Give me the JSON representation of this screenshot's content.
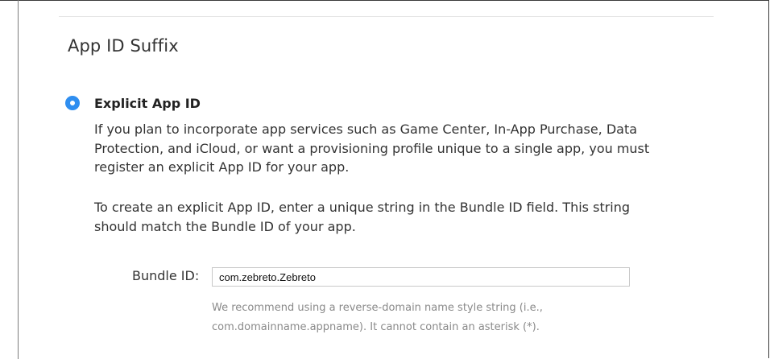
{
  "section": {
    "title": "App ID Suffix"
  },
  "option": {
    "label": "Explicit App ID",
    "selected": true,
    "accent_color": "#2f8ef0",
    "description_1": "If you plan to incorporate app services such as Game Center, In-App Purchase, Data Protection, and iCloud, or want a provisioning profile unique to a single app, you must register an explicit App ID for your app.",
    "description_2": "To create an explicit App ID, enter a unique string in the Bundle ID field. This string should match the Bundle ID of your app."
  },
  "bundle": {
    "label": "Bundle ID:",
    "value": "com.zebreto.Zebreto",
    "help_line_1": "We recommend using a reverse-domain name style string (i.e.,",
    "help_line_2": "com.domainname.appname). It cannot contain an asterisk (*)."
  }
}
